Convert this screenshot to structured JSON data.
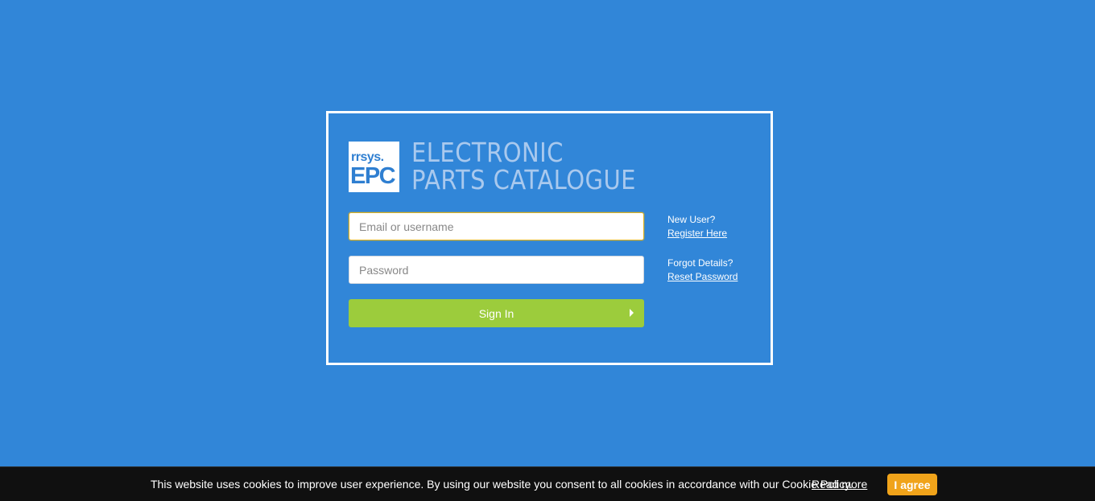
{
  "brand": {
    "logo_small": "rrsys.",
    "logo_big": "EPC",
    "title_line1": "ELECTRONIC",
    "title_line2": "PARTS CATALOGUE"
  },
  "login": {
    "email_placeholder": "Email or username",
    "password_placeholder": "Password",
    "signin_label": "Sign In"
  },
  "links": {
    "new_user_label": "New User?",
    "register_label": "Register Here",
    "forgot_label": "Forgot Details?",
    "reset_label": "Reset Password"
  },
  "cookie": {
    "message": "This website uses cookies to improve user experience. By using our website you consent to all cookies in accordance with our Cookie Policy.",
    "read_more": "Read more",
    "agree": "I agree"
  },
  "colors": {
    "background": "#3186d8",
    "signin_button": "#9ccc3c",
    "agree_button": "#f0a31a",
    "cookie_bar": "#101010"
  }
}
